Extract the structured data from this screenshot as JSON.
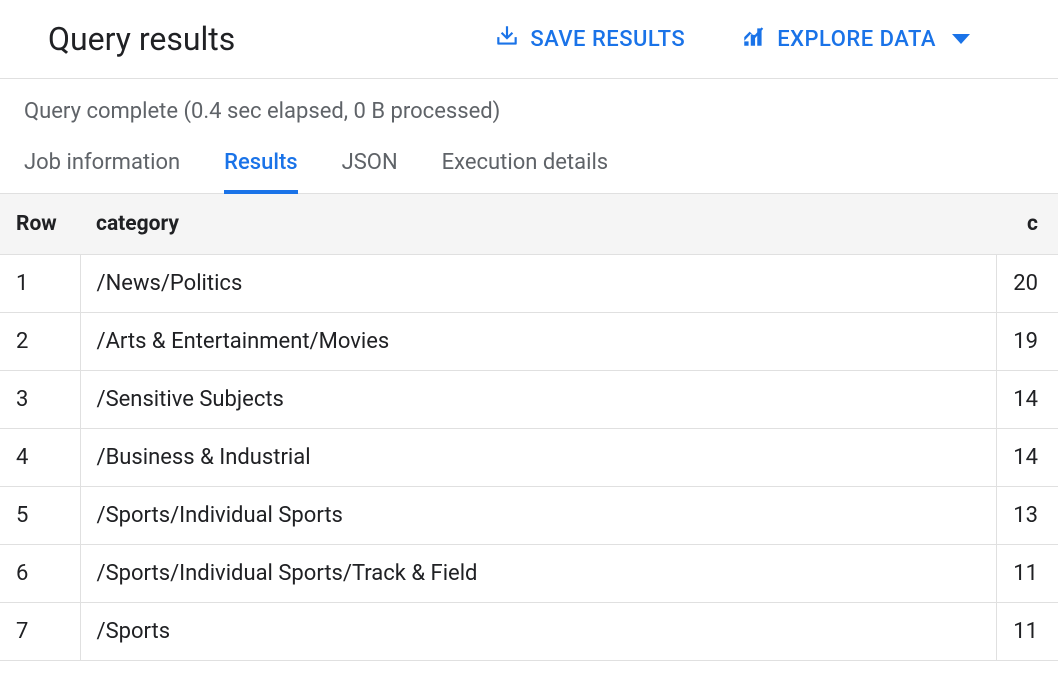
{
  "header": {
    "title": "Query results",
    "save_results_label": "SAVE RESULTS",
    "explore_data_label": "EXPLORE DATA"
  },
  "status": "Query complete (0.4 sec elapsed, 0 B processed)",
  "tabs": [
    {
      "label": "Job information",
      "active": false
    },
    {
      "label": "Results",
      "active": true
    },
    {
      "label": "JSON",
      "active": false
    },
    {
      "label": "Execution details",
      "active": false
    }
  ],
  "table": {
    "columns": [
      "Row",
      "category",
      "c"
    ],
    "rows": [
      {
        "row": 1,
        "category": "/News/Politics",
        "c": 20
      },
      {
        "row": 2,
        "category": "/Arts & Entertainment/Movies",
        "c": 19
      },
      {
        "row": 3,
        "category": "/Sensitive Subjects",
        "c": 14
      },
      {
        "row": 4,
        "category": "/Business & Industrial",
        "c": 14
      },
      {
        "row": 5,
        "category": "/Sports/Individual Sports",
        "c": 13
      },
      {
        "row": 6,
        "category": "/Sports/Individual Sports/Track & Field",
        "c": 11
      },
      {
        "row": 7,
        "category": "/Sports",
        "c": 11
      }
    ]
  }
}
